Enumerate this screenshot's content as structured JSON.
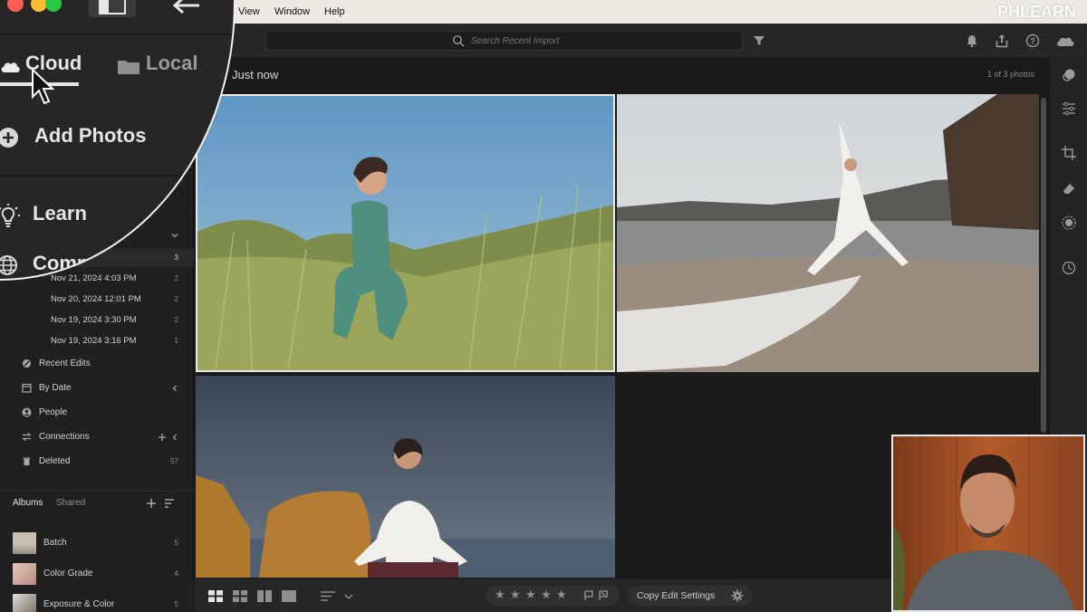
{
  "menubar": {
    "items": [
      "View",
      "Window",
      "Help"
    ],
    "brand": "PHLEARN"
  },
  "toolbar": {
    "search_placeholder": "Search Recent Import",
    "icons": [
      "filter-icon",
      "bell-icon",
      "share-icon",
      "help-icon",
      "cloud-icon"
    ]
  },
  "magnifier": {
    "tabs": [
      {
        "label": "Cloud",
        "icon": "cloud-icon",
        "selected": true
      },
      {
        "label": "Local",
        "icon": "folder-icon",
        "selected": false
      }
    ],
    "add_photos": "Add Photos",
    "learn": "Learn",
    "community": "Commu"
  },
  "sidebar": {
    "top_count": "3",
    "imports": [
      {
        "label": "Nov 21, 2024 4:03 PM",
        "count": "2"
      },
      {
        "label": "Nov 20, 2024 12:01 PM",
        "count": "2"
      },
      {
        "label": "Nov 19, 2024 3:30 PM",
        "count": "2"
      },
      {
        "label": "Nov 19, 2024 3:16 PM",
        "count": "1"
      }
    ],
    "nav": [
      {
        "label": "Recent Edits",
        "icon": "recent-edits-icon"
      },
      {
        "label": "By Date",
        "icon": "calendar-icon"
      },
      {
        "label": "People",
        "icon": "person-icon"
      },
      {
        "label": "Connections",
        "icon": "connections-icon"
      },
      {
        "label": "Deleted",
        "icon": "trash-icon",
        "count": "57"
      }
    ],
    "album_tabs": [
      "Albums",
      "Shared"
    ],
    "albums": [
      {
        "label": "Batch",
        "count": "5"
      },
      {
        "label": "Color Grade",
        "count": "4"
      },
      {
        "label": "Exposure & Color",
        "count": "5"
      }
    ]
  },
  "main": {
    "group_title": "Just now",
    "photo_count": "1 of 3 photos",
    "selected_photo": 1
  },
  "bottombar": {
    "rating_stars": 5,
    "copy_edit": "Copy Edit Settings"
  },
  "colors": {
    "panel": "#262626",
    "sidebar": "#202020",
    "grid_bg": "#1a1a1a",
    "selection": "#e8e8e8"
  }
}
